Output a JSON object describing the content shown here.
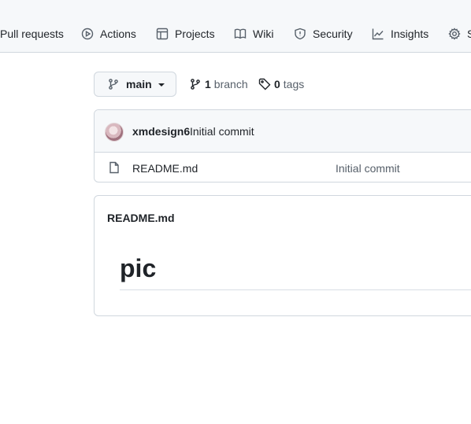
{
  "nav": {
    "items": [
      {
        "label": "Pull requests",
        "icon": "pull-request-icon"
      },
      {
        "label": "Actions",
        "icon": "play-icon"
      },
      {
        "label": "Projects",
        "icon": "table-icon"
      },
      {
        "label": "Wiki",
        "icon": "book-icon"
      },
      {
        "label": "Security",
        "icon": "shield-icon"
      },
      {
        "label": "Insights",
        "icon": "graph-icon"
      },
      {
        "label": "S",
        "icon": "gear-icon"
      }
    ]
  },
  "toolbar": {
    "branch_name": "main",
    "branch_count": "1",
    "branch_label": "branch",
    "tag_count": "0",
    "tag_label": "tags"
  },
  "commit": {
    "author": "xmdesign6",
    "message": "Initial commit"
  },
  "files": [
    {
      "name": "README.md",
      "last_commit": "Initial commit"
    }
  ],
  "readme": {
    "title": "README.md",
    "heading": "pic"
  },
  "colors": {
    "text": "#1f2328",
    "muted": "#57606a",
    "border": "#d0d7de",
    "subtle_bg": "#f6f8fa"
  }
}
